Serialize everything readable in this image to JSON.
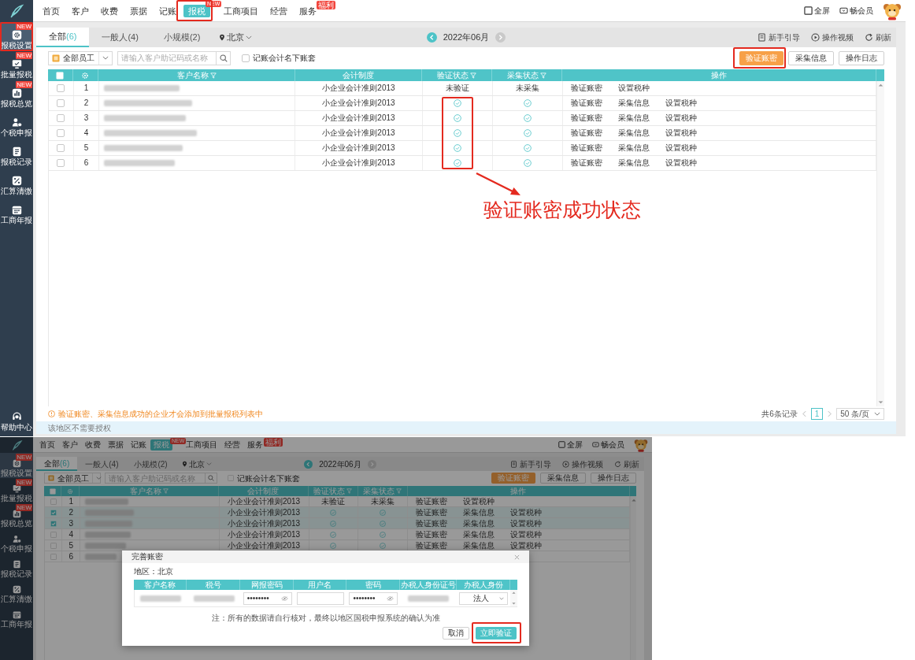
{
  "screens": [
    {
      "sidebar": {
        "items": [
          {
            "label": "报税设置",
            "selected": true,
            "badge": "NEW",
            "highlighted": true
          },
          {
            "label": "批量报税",
            "selected": false,
            "badge": "NEW",
            "highlighted": false
          },
          {
            "label": "报税总览",
            "selected": false,
            "badge": "NEW",
            "highlighted": false
          },
          {
            "label": "个税申报",
            "selected": false,
            "highlighted": false
          },
          {
            "label": "报税记录",
            "selected": false,
            "highlighted": false
          },
          {
            "label": "汇算清缴",
            "selected": false,
            "highlighted": false
          },
          {
            "label": "工商年报",
            "selected": false,
            "highlighted": false
          }
        ],
        "help": {
          "label": "帮助中心"
        }
      },
      "nav": {
        "items": [
          {
            "label": "首页",
            "selected": false,
            "highlighted": false
          },
          {
            "label": "客户",
            "selected": false,
            "highlighted": false
          },
          {
            "label": "收费",
            "selected": false,
            "highlighted": false
          },
          {
            "label": "票据",
            "selected": false,
            "highlighted": false
          },
          {
            "label": "记账",
            "selected": false,
            "highlighted": false
          },
          {
            "label": "报税",
            "selected": true,
            "badge": "NEW",
            "highlighted": true
          },
          {
            "label": "工商项目",
            "selected": false,
            "highlighted": false
          },
          {
            "label": "经营",
            "selected": false,
            "highlighted": false
          },
          {
            "label": "服务",
            "selected": false,
            "badge": "福利",
            "highlighted": false
          }
        ],
        "actions": [
          {
            "label": "全屏"
          },
          {
            "label": "畅会员"
          }
        ]
      },
      "tabs": [
        {
          "label": "全部",
          "count": "(6)",
          "selected": true
        },
        {
          "label": "一般人",
          "count": "(4)",
          "selected": false
        },
        {
          "label": "小规模",
          "count": "(2)",
          "selected": false
        }
      ],
      "region": "北京",
      "period": "2022年06月",
      "links": [
        {
          "label": "新手引导"
        },
        {
          "label": "操作视频"
        },
        {
          "label": "刷新"
        }
      ],
      "filters": {
        "staff": "全部员工",
        "search_placeholder": "请输入客户助记码或名称",
        "own_books": {
          "label": "记账会计名下账套",
          "checked": false
        }
      },
      "buttons": [
        {
          "label": "验证账密",
          "primary": true,
          "highlighted": true
        },
        {
          "label": "采集信息",
          "primary": false,
          "highlighted": false
        },
        {
          "label": "操作日志",
          "primary": false,
          "highlighted": false
        }
      ],
      "table": {
        "columns": [
          {
            "kind": "select",
            "checked": false,
            "highlighted": false
          },
          {
            "kind": "settings",
            "highlighted": false
          },
          {
            "kind": "text",
            "label": "客户名称",
            "filter": true,
            "highlighted": false
          },
          {
            "kind": "text",
            "label": "会计制度",
            "filter": false,
            "highlighted": false
          },
          {
            "kind": "text",
            "label": "验证状态",
            "filter": true,
            "highlighted": true
          },
          {
            "kind": "text",
            "label": "采集状态",
            "filter": true,
            "highlighted": false
          },
          {
            "kind": "text",
            "label": "操作",
            "filter": false,
            "highlighted": false
          }
        ],
        "rows": [
          {
            "selected": false,
            "number": "1",
            "standard": "小企业会计准则2013",
            "verified": false,
            "verify_text": "未验证",
            "collected": false,
            "collect_text": "未采集",
            "actions": [
              "验证账密",
              "设置税种"
            ]
          },
          {
            "selected": false,
            "number": "2",
            "standard": "小企业会计准则2013",
            "verified": true,
            "collected": true,
            "actions": [
              "验证账密",
              "采集信息",
              "设置税种"
            ]
          },
          {
            "selected": false,
            "number": "3",
            "standard": "小企业会计准则2013",
            "verified": true,
            "collected": true,
            "actions": [
              "验证账密",
              "采集信息",
              "设置税种"
            ]
          },
          {
            "selected": false,
            "number": "4",
            "standard": "小企业会计准则2013",
            "verified": true,
            "collected": true,
            "actions": [
              "验证账密",
              "采集信息",
              "设置税种"
            ]
          },
          {
            "selected": false,
            "number": "5",
            "standard": "小企业会计准则2013",
            "verified": true,
            "collected": true,
            "actions": [
              "验证账密",
              "采集信息",
              "设置税种"
            ]
          },
          {
            "selected": false,
            "number": "6",
            "standard": "小企业会计准则2013",
            "verified": true,
            "collected": true,
            "actions": [
              "验证账密",
              "采集信息",
              "设置税种"
            ]
          }
        ]
      },
      "notice": "验证账密、采集信息成功的企业才会添加到批量报税列表中",
      "pagination": {
        "total": "共6条记录",
        "page": "1",
        "page_size": "50 条/页"
      },
      "status_bar": "该地区不需要授权"
    },
    {
      "sidebar": {
        "items": [
          {
            "label": "报税设置",
            "selected": true,
            "badge": "NEW",
            "highlighted": false
          },
          {
            "label": "批量报税",
            "selected": false,
            "badge": "NEW",
            "highlighted": false
          },
          {
            "label": "报税总览",
            "selected": false,
            "badge": "NEW",
            "highlighted": false
          },
          {
            "label": "个税申报",
            "selected": false,
            "highlighted": false
          },
          {
            "label": "报税记录",
            "selected": false,
            "highlighted": false
          },
          {
            "label": "汇算清缴",
            "selected": false,
            "highlighted": false
          },
          {
            "label": "工商年报",
            "selected": false,
            "highlighted": false
          }
        ]
      },
      "nav": {
        "items": [
          {
            "label": "首页",
            "selected": false,
            "highlighted": false
          },
          {
            "label": "客户",
            "selected": false,
            "highlighted": false
          },
          {
            "label": "收费",
            "selected": false,
            "highlighted": false
          },
          {
            "label": "票据",
            "selected": false,
            "highlighted": false
          },
          {
            "label": "记账",
            "selected": false,
            "highlighted": false
          },
          {
            "label": "报税",
            "selected": true,
            "badge": "NEW",
            "highlighted": false
          },
          {
            "label": "工商项目",
            "selected": false,
            "highlighted": false
          },
          {
            "label": "经营",
            "selected": false,
            "highlighted": false
          },
          {
            "label": "服务",
            "selected": false,
            "badge": "福利",
            "highlighted": false
          }
        ],
        "actions": [
          {
            "label": "全屏"
          },
          {
            "label": "畅会员"
          }
        ]
      },
      "tabs": [
        {
          "label": "全部",
          "count": "(6)",
          "selected": true
        },
        {
          "label": "一般人",
          "count": "(4)",
          "selected": false
        },
        {
          "label": "小规模",
          "count": "(2)",
          "selected": false
        }
      ],
      "region": "北京",
      "period": "2022年06月",
      "links": [
        {
          "label": "新手引导"
        },
        {
          "label": "操作视频"
        },
        {
          "label": "刷新"
        }
      ],
      "filters": {
        "staff": "全部员工",
        "search_placeholder": "请输入客户助记码或名称",
        "own_books": {
          "label": "记账会计名下账套",
          "checked": false
        }
      },
      "buttons": [
        {
          "label": "验证账密",
          "primary": true,
          "highlighted": false
        },
        {
          "label": "采集信息",
          "primary": false,
          "highlighted": false
        },
        {
          "label": "操作日志",
          "primary": false,
          "highlighted": false
        }
      ],
      "table": {
        "columns": [
          {
            "kind": "select",
            "checked": false,
            "highlighted": false
          },
          {
            "kind": "settings",
            "highlighted": false
          },
          {
            "kind": "text",
            "label": "客户名称",
            "filter": true,
            "highlighted": false
          },
          {
            "kind": "text",
            "label": "会计制度",
            "filter": false,
            "highlighted": false
          },
          {
            "kind": "text",
            "label": "验证状态",
            "filter": true,
            "highlighted": false
          },
          {
            "kind": "text",
            "label": "采集状态",
            "filter": true,
            "highlighted": false
          },
          {
            "kind": "text",
            "label": "操作",
            "filter": false,
            "highlighted": false
          }
        ],
        "rows": [
          {
            "selected": false,
            "number": "1",
            "standard": "小企业会计准则2013",
            "verified": false,
            "verify_text": "未验证",
            "collected": false,
            "collect_text": "未采集",
            "actions": [
              "验证账密",
              "设置税种"
            ]
          },
          {
            "selected": true,
            "number": "2",
            "standard": "小企业会计准则2013",
            "verified": true,
            "collected": true,
            "actions": [
              "验证账密",
              "采集信息",
              "设置税种"
            ]
          },
          {
            "selected": true,
            "number": "3",
            "standard": "小企业会计准则2013",
            "verified": true,
            "collected": true,
            "actions": [
              "验证账密",
              "采集信息",
              "设置税种"
            ]
          },
          {
            "selected": false,
            "number": "4",
            "standard": "小企业会计准则2013",
            "verified": true,
            "collected": true,
            "actions": [
              "验证账密",
              "采集信息",
              "设置税种"
            ]
          },
          {
            "selected": false,
            "number": "5",
            "standard": "小企业会计准则2013",
            "verified": true,
            "collected": true,
            "actions": [
              "验证账密",
              "采集信息",
              "设置税种"
            ]
          },
          {
            "selected": false,
            "number": "6"
          }
        ]
      },
      "dialog": {
        "title": "完善账密",
        "region": "地区：北京",
        "columns": [
          "客户名称",
          "税号",
          "网报密码",
          "用户名",
          "密码",
          "办税人身份证号",
          "办税人身份"
        ],
        "row": [
          {
            "kind": "redacted"
          },
          {
            "kind": "redacted"
          },
          {
            "kind": "password",
            "value": "••••••••"
          },
          {
            "kind": "input"
          },
          {
            "kind": "password",
            "value": "••••••••"
          },
          {
            "kind": "redacted"
          },
          {
            "kind": "select",
            "value": "法人"
          }
        ],
        "note": "注：所有的数据请自行核对，最终以地区国税申报系统的确认为准",
        "buttons": [
          {
            "label": "取消",
            "primary": false,
            "highlighted": false
          },
          {
            "label": "立即验证",
            "primary": true,
            "highlighted": true
          }
        ]
      }
    }
  ],
  "annotation": {
    "text": "验证账密成功状态"
  }
}
